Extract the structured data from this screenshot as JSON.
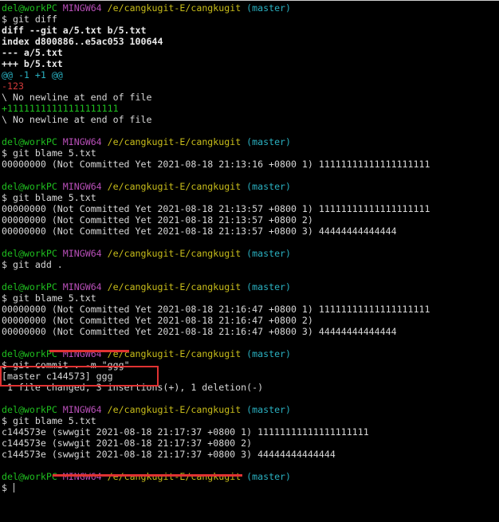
{
  "terminal": {
    "prompt": {
      "user_host": "del@workPC",
      "system": "MINGW64",
      "path": "/e/cangkugit-E/cangkugit",
      "branch": "(master)",
      "symbol": "$"
    },
    "session": [
      {
        "kind": "prompt"
      },
      {
        "kind": "command",
        "text": "git diff"
      },
      {
        "kind": "out",
        "color": "bold",
        "text": "diff --git a/5.txt b/5.txt"
      },
      {
        "kind": "out",
        "color": "bold",
        "text": "index d800886..e5ac053 100644"
      },
      {
        "kind": "out",
        "color": "bold",
        "text": "--- a/5.txt"
      },
      {
        "kind": "out",
        "color": "bold",
        "text": "+++ b/5.txt"
      },
      {
        "kind": "out",
        "color": "cyan",
        "text": "@@ -1 +1 @@"
      },
      {
        "kind": "out",
        "color": "red",
        "text": "-123"
      },
      {
        "kind": "out",
        "color": "plain",
        "text": "\\ No newline at end of file"
      },
      {
        "kind": "out",
        "color": "green",
        "text": "+11111111111111111111"
      },
      {
        "kind": "out",
        "color": "plain",
        "text": "\\ No newline at end of file"
      },
      {
        "kind": "blank"
      },
      {
        "kind": "prompt"
      },
      {
        "kind": "command",
        "text": "git blame 5.txt"
      },
      {
        "kind": "out",
        "color": "plain",
        "text": "00000000 (Not Committed Yet 2021-08-18 21:13:16 +0800 1) 11111111111111111111"
      },
      {
        "kind": "blank"
      },
      {
        "kind": "prompt"
      },
      {
        "kind": "command",
        "text": "git blame 5.txt"
      },
      {
        "kind": "out",
        "color": "plain",
        "text": "00000000 (Not Committed Yet 2021-08-18 21:13:57 +0800 1) 11111111111111111111"
      },
      {
        "kind": "out",
        "color": "plain",
        "text": "00000000 (Not Committed Yet 2021-08-18 21:13:57 +0800 2)"
      },
      {
        "kind": "out",
        "color": "plain",
        "text": "00000000 (Not Committed Yet 2021-08-18 21:13:57 +0800 3) 44444444444444"
      },
      {
        "kind": "blank"
      },
      {
        "kind": "prompt"
      },
      {
        "kind": "command",
        "text": "git add ."
      },
      {
        "kind": "blank"
      },
      {
        "kind": "prompt"
      },
      {
        "kind": "command",
        "text": "git blame 5.txt"
      },
      {
        "kind": "out",
        "color": "plain",
        "text": "00000000 (Not Committed Yet 2021-08-18 21:16:47 +0800 1) 11111111111111111111"
      },
      {
        "kind": "out",
        "color": "plain",
        "text": "00000000 (Not Committed Yet 2021-08-18 21:16:47 +0800 2)"
      },
      {
        "kind": "out",
        "color": "plain",
        "text": "00000000 (Not Committed Yet 2021-08-18 21:16:47 +0800 3) 44444444444444"
      },
      {
        "kind": "blank"
      },
      {
        "kind": "prompt"
      },
      {
        "kind": "command",
        "text": "git commit . -m \"ggg\""
      },
      {
        "kind": "out",
        "color": "plain",
        "text": "[master c144573] ggg"
      },
      {
        "kind": "out",
        "color": "plain",
        "text": " 1 file changed, 3 insertions(+), 1 deletion(-)"
      },
      {
        "kind": "blank"
      },
      {
        "kind": "prompt"
      },
      {
        "kind": "command",
        "text": "git blame 5.txt"
      },
      {
        "kind": "out",
        "color": "plain",
        "text": "c144573e (swwgit 2021-08-18 21:17:37 +0800 1) 11111111111111111111"
      },
      {
        "kind": "out",
        "color": "plain",
        "text": "c144573e (swwgit 2021-08-18 21:17:37 +0800 2)"
      },
      {
        "kind": "out",
        "color": "plain",
        "text": "c144573e (swwgit 2021-08-18 21:17:37 +0800 3) 44444444444444"
      },
      {
        "kind": "blank"
      },
      {
        "kind": "prompt"
      },
      {
        "kind": "command",
        "text": "",
        "cursor": true
      }
    ]
  },
  "colors": {
    "background": "#000000",
    "prompt_user": "#1fbf1f",
    "prompt_system": "#b84fb8",
    "prompt_path": "#c8bd1a",
    "prompt_branch": "#2ab0c0",
    "diff_removed": "#d23a3a",
    "diff_added": "#1fbf1f",
    "annotation": "#e03232"
  }
}
